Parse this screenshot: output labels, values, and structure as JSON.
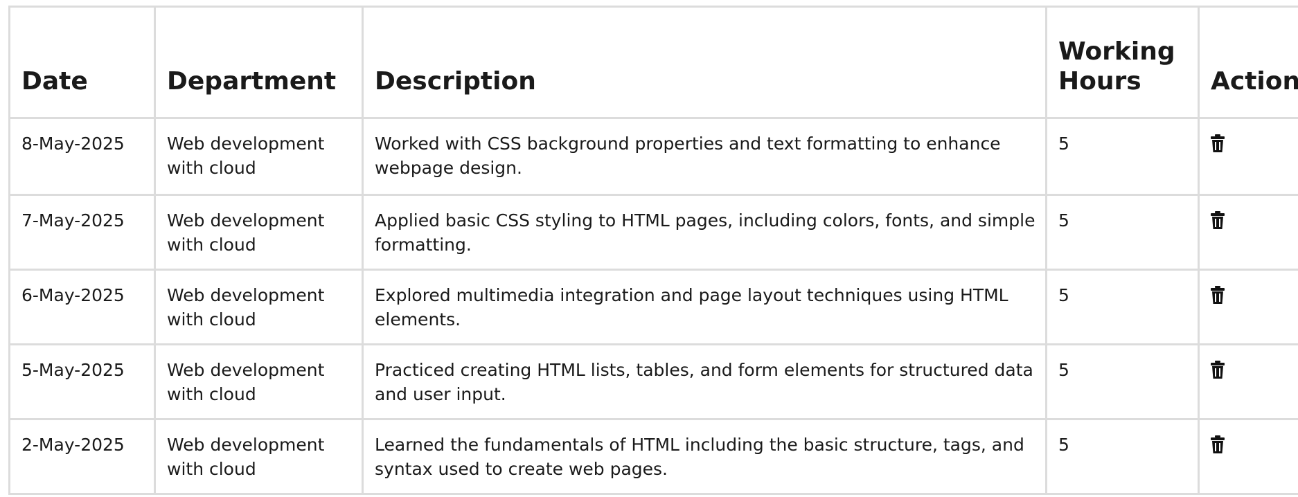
{
  "table": {
    "headers": {
      "date": "Date",
      "department": "Department",
      "description": "Description",
      "hours": "Working Hours",
      "action": "Action"
    },
    "rows": [
      {
        "date": "8-May-2025",
        "department": "Web development with cloud",
        "description": "Worked with CSS background properties and text formatting to enhance webpage design.",
        "hours": "5",
        "action_icon": "trash-icon"
      },
      {
        "date": "7-May-2025",
        "department": "Web development with cloud",
        "description": "Applied basic CSS styling to HTML pages, including colors, fonts, and simple formatting.",
        "hours": "5",
        "action_icon": "trash-icon"
      },
      {
        "date": "6-May-2025",
        "department": "Web development with cloud",
        "description": "Explored multimedia integration and page layout techniques using HTML elements.",
        "hours": "5",
        "action_icon": "trash-icon"
      },
      {
        "date": "5-May-2025",
        "department": "Web development with cloud",
        "description": "Practiced creating HTML lists, tables, and form elements for structured data and user input.",
        "hours": "5",
        "action_icon": "trash-icon"
      },
      {
        "date": "2-May-2025",
        "department": "Web development with cloud",
        "description": "Learned the fundamentals of HTML including the basic structure, tags, and syntax used to create web pages.",
        "hours": "5",
        "action_icon": "trash-icon"
      }
    ]
  },
  "colors": {
    "border": "#dcdcdc",
    "text": "#1a1a1a",
    "background": "#ffffff"
  }
}
